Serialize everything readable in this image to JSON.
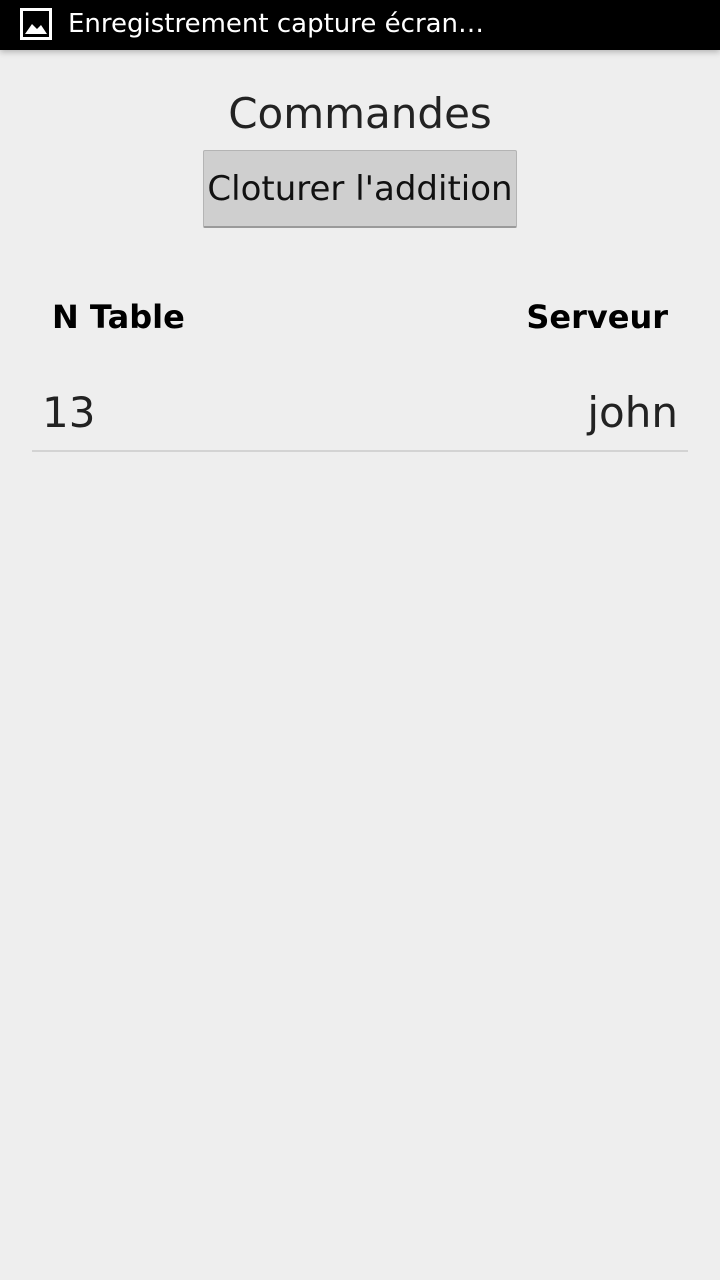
{
  "status_bar": {
    "notification_icon": "image-icon",
    "notification_text": "Enregistrement capture écran…"
  },
  "page": {
    "title": "Commandes",
    "close_bill_label": "Cloturer l'addition"
  },
  "table": {
    "headers": {
      "table_number": "N Table",
      "server": "Serveur"
    },
    "rows": [
      {
        "table_number": "13",
        "server": "john"
      }
    ]
  }
}
